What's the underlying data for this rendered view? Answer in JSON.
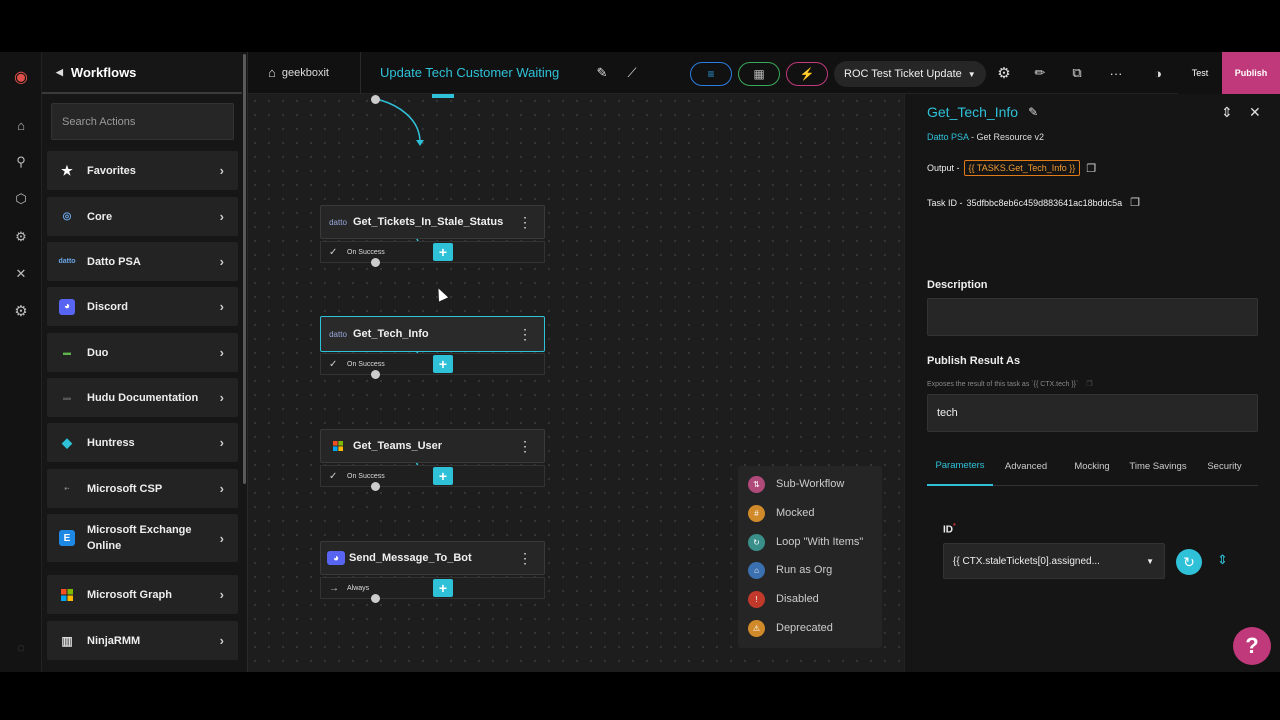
{
  "sidebar": {
    "title": "Workflows",
    "search_placeholder": "Search Actions",
    "items": [
      {
        "label": "Favorites",
        "icon": "star-icon",
        "color": "#ffffff"
      },
      {
        "label": "Core",
        "icon": "core-icon",
        "color": "#6aa6e8"
      },
      {
        "label": "Datto PSA",
        "icon": "datto-icon",
        "color": "#6aa6e8"
      },
      {
        "label": "Discord",
        "icon": "discord-icon",
        "color": "#5865f2"
      },
      {
        "label": "Duo",
        "icon": "duo-icon",
        "color": "#5db44a"
      },
      {
        "label": "Hudu Documentation",
        "icon": "hudu-icon",
        "color": "#555555"
      },
      {
        "label": "Huntress",
        "icon": "huntress-icon",
        "color": "#2fc1d8"
      },
      {
        "label": "Microsoft CSP",
        "icon": "microsoft-csp-icon",
        "color": "#888888"
      },
      {
        "label": "Microsoft Exchange Online",
        "icon": "exchange-icon",
        "color": "#1e88e5"
      },
      {
        "label": "Microsoft Graph",
        "icon": "microsoft-graph-icon",
        "color": "#f25022"
      },
      {
        "label": "NinjaRMM",
        "icon": "ninjarmm-icon",
        "color": "#dddddd"
      }
    ]
  },
  "topbar": {
    "org": "geekboxit",
    "workflow_name": "Update Tech Customer Waiting",
    "trigger_dropdown": "ROC Test Ticket Update",
    "test_label": "Test",
    "publish_label": "Publish"
  },
  "canvas": {
    "nodes": [
      {
        "label": "Get_Tickets_In_Stale_Status",
        "icon": "datto-icon",
        "outlet": "On Success",
        "outlet_icon": "check-icon"
      },
      {
        "label": "Get_Tech_Info",
        "icon": "datto-icon",
        "outlet": "On Success",
        "outlet_icon": "check-icon",
        "selected": true
      },
      {
        "label": "Get_Teams_User",
        "icon": "microsoft-teams-icon",
        "outlet": "On Success",
        "outlet_icon": "check-icon"
      },
      {
        "label": "Send_Message_To_Bot",
        "icon": "discord-icon",
        "outlet": "Always",
        "outlet_icon": "arrow-right-icon"
      }
    ],
    "legend": [
      {
        "label": "Sub-Workflow",
        "color": "#b04a7a"
      },
      {
        "label": "Mocked",
        "color": "#d08a2a"
      },
      {
        "label": "Loop \"With Items\"",
        "color": "#3a8f8a"
      },
      {
        "label": "Run as Org",
        "color": "#3a6fb0"
      },
      {
        "label": "Disabled",
        "color": "#c0392b"
      },
      {
        "label": "Deprecated",
        "color": "#d08a2a"
      }
    ]
  },
  "panel": {
    "title": "Get_Tech_Info",
    "vendor": "Datto PSA",
    "action": " - Get Resource v2",
    "output_label": "Output -",
    "output_value": "{{ TASKS.Get_Tech_Info }}",
    "task_id_label": "Task ID -",
    "task_id": "35dfbbc8eb6c459d883641ac18bddc5a",
    "description_label": "Description",
    "description_value": "",
    "publish_label": "Publish Result As",
    "publish_hint": "Exposes the result of this task as `{{ CTX.tech }}`",
    "publish_value": "tech",
    "tabs": [
      "Parameters",
      "Advanced",
      "Mocking",
      "Time Savings",
      "Security"
    ],
    "id_label": "ID",
    "id_value": "{{ CTX.staleTickets[0].assigned..."
  },
  "colors": {
    "accent": "#2fc1d8",
    "publish": "#c0397a",
    "orange": "#f29b32"
  }
}
